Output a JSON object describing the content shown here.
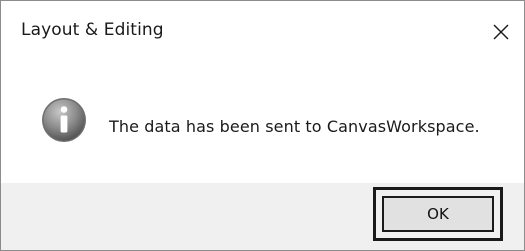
{
  "dialog": {
    "title": "Layout & Editing",
    "close_icon": "close-icon",
    "message": "The data has been sent to CanvasWorkspace.",
    "message_icon": "info-icon",
    "ok_label": "OK"
  },
  "colors": {
    "footer_bg": "#f0f0f0",
    "icon_gradient_light": "#b9b9b9",
    "icon_gradient_dark": "#5a5a5a"
  }
}
